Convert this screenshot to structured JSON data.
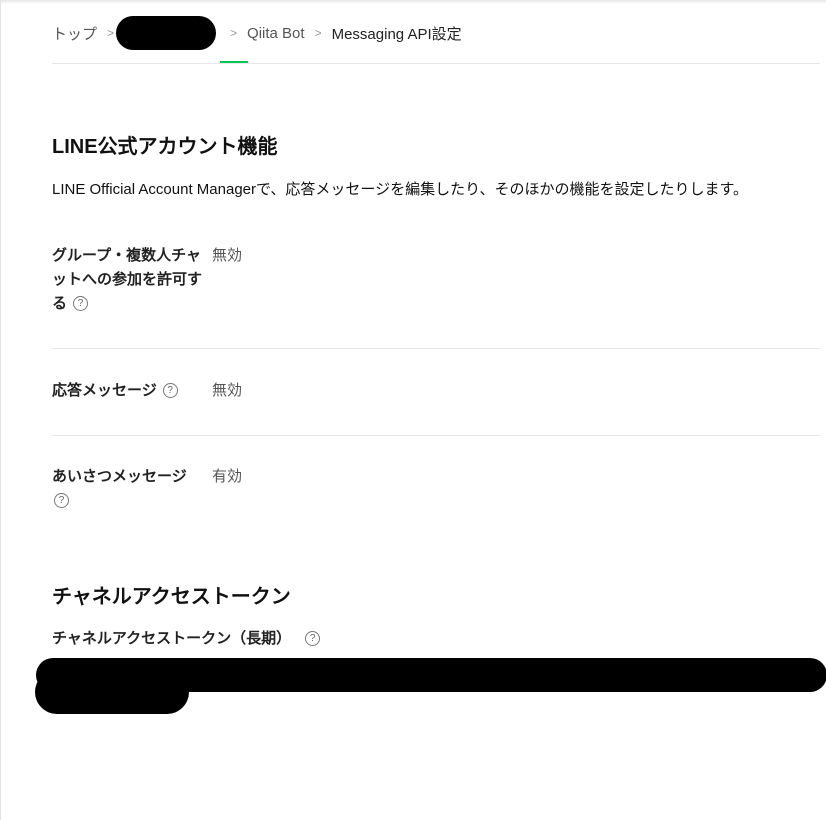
{
  "breadcrumb": {
    "items": [
      "トップ",
      "Qiita Bot",
      "Messaging API設定"
    ],
    "separator": ">"
  },
  "accent_color": "#06c755",
  "line_section": {
    "title": "LINE公式アカウント機能",
    "description": "LINE Official Account Managerで、応答メッセージを編集したり、そのほかの機能を設定したりします。",
    "settings": [
      {
        "label": "グループ・複数人チャットへの参加を許可する",
        "value": "無効",
        "help_icon": "help-icon"
      },
      {
        "label": "応答メッセージ",
        "value": "無効",
        "help_icon": "help-icon"
      },
      {
        "label": "あいさつメッセージ",
        "value": "有効",
        "help_icon": "help-icon"
      }
    ]
  },
  "token_section": {
    "title": "チャネルアクセストークン",
    "token_label": "チャネルアクセストークン（長期）",
    "help_icon": "help-icon"
  },
  "help_glyph": "?"
}
